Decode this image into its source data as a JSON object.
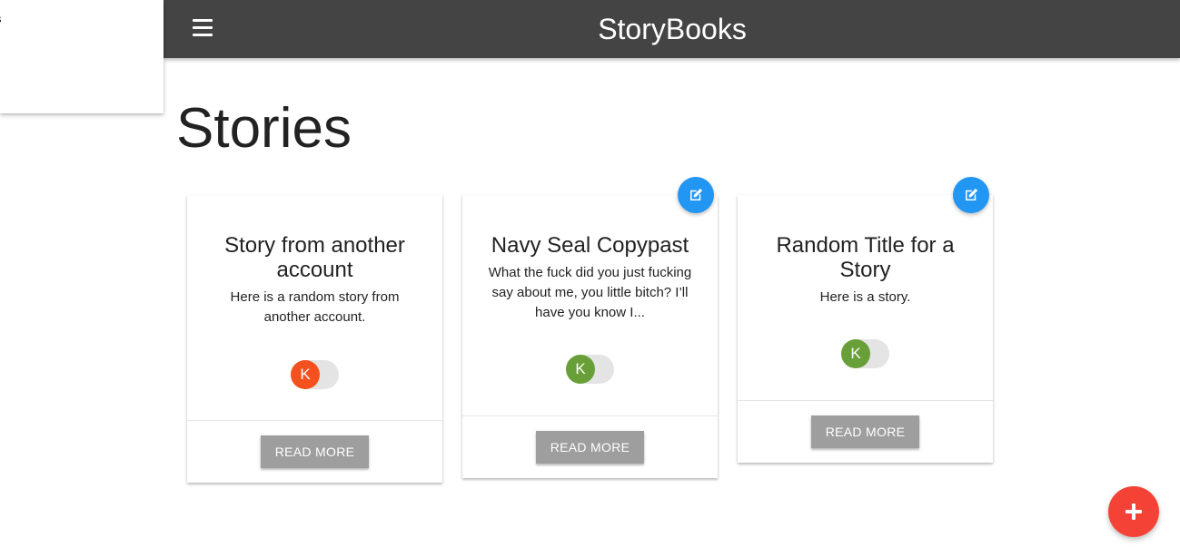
{
  "sidenav": {
    "visible_item": "s"
  },
  "navbar": {
    "brand": "StoryBooks",
    "menu_icon": "menu-icon"
  },
  "page_title": "Stories",
  "stories": [
    {
      "title": "Story from another account",
      "text": "Here is a random story from another account.",
      "avatar_initial": "K",
      "avatar_color": "#f4511e",
      "editable": false,
      "read_more": "READ MORE"
    },
    {
      "title": "Navy Seal Copypast",
      "text": "What the fuck did you just fucking say about me, you little bitch? I’ll have you know I...",
      "avatar_initial": "K",
      "avatar_color": "#689f38",
      "editable": true,
      "edit_icon": "edit-icon",
      "read_more": "READ MORE"
    },
    {
      "title": "Random Title for a Story",
      "text": "Here is a story.",
      "avatar_initial": "K",
      "avatar_color": "#689f38",
      "editable": true,
      "edit_icon": "edit-icon",
      "read_more": "READ MORE"
    }
  ],
  "fab": {
    "icon": "add-icon",
    "color": "#f44336"
  },
  "colors": {
    "navbar": "#444444",
    "button": "#9e9e9e",
    "edit": "#2196f3"
  }
}
